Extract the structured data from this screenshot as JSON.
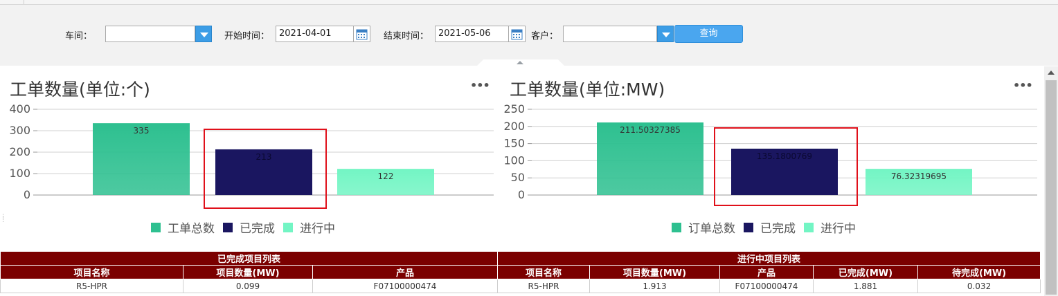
{
  "filter": {
    "workshop_label": "车间：",
    "workshop_value": "",
    "start_label": "开始时间：",
    "start_value": "2021-04-01",
    "end_label": "结束时间：",
    "end_value": "2021-05-06",
    "customer_label": "客户：",
    "customer_value": "",
    "query_label": "查询"
  },
  "chart1": {
    "title": "工单数量(单位:个)",
    "more": "•••",
    "legend": [
      "工单总数",
      "已完成",
      "进行中"
    ]
  },
  "chart2": {
    "title": "工单数量(单位:MW)",
    "more": "•••",
    "legend": [
      "订单总数",
      "已完成",
      "进行中"
    ]
  },
  "chart_data": [
    {
      "type": "bar",
      "title": "工单数量(单位:个)",
      "categories": [
        "工单总数",
        "已完成",
        "进行中"
      ],
      "values": [
        335,
        213,
        122
      ],
      "labels": [
        "335",
        "213",
        "122"
      ],
      "colors": [
        "#2ec090",
        "#1a1660",
        "#73f5c4"
      ],
      "ylim": [
        0,
        400
      ],
      "yticks": [
        "400",
        "300",
        "200",
        "100",
        "0"
      ],
      "grid": true,
      "legend_position": "bottom"
    },
    {
      "type": "bar",
      "title": "工单数量(单位:MW)",
      "categories": [
        "订单总数",
        "已完成",
        "进行中"
      ],
      "values": [
        211.50327385,
        135.1800769,
        76.32319695
      ],
      "labels": [
        "211.50327385",
        "135.1800769",
        "76.32319695"
      ],
      "colors": [
        "#2ec090",
        "#1a1660",
        "#73f5c4"
      ],
      "ylim": [
        0,
        250
      ],
      "yticks": [
        "250",
        "200",
        "150",
        "100",
        "50",
        "0"
      ],
      "grid": true,
      "legend_position": "bottom"
    }
  ],
  "completed_table": {
    "title": "已完成项目列表",
    "headers": [
      "项目名称",
      "项目数量(MW)",
      "产品"
    ],
    "row": [
      "R5-HPR",
      "0.099",
      "F07100000474"
    ]
  },
  "inprogress_table": {
    "title": "进行中项目列表",
    "headers": [
      "项目名称",
      "项目数量(MW)",
      "产品",
      "已完成(MW)",
      "待完成(MW)"
    ],
    "row": [
      "R5-HPR",
      "1.913",
      "F07100000474",
      "1.881",
      "0.032"
    ]
  },
  "colors": {
    "highlight_box": "#e0101a",
    "table_header": "#7b0000",
    "query_button": "#4aa6ef"
  }
}
